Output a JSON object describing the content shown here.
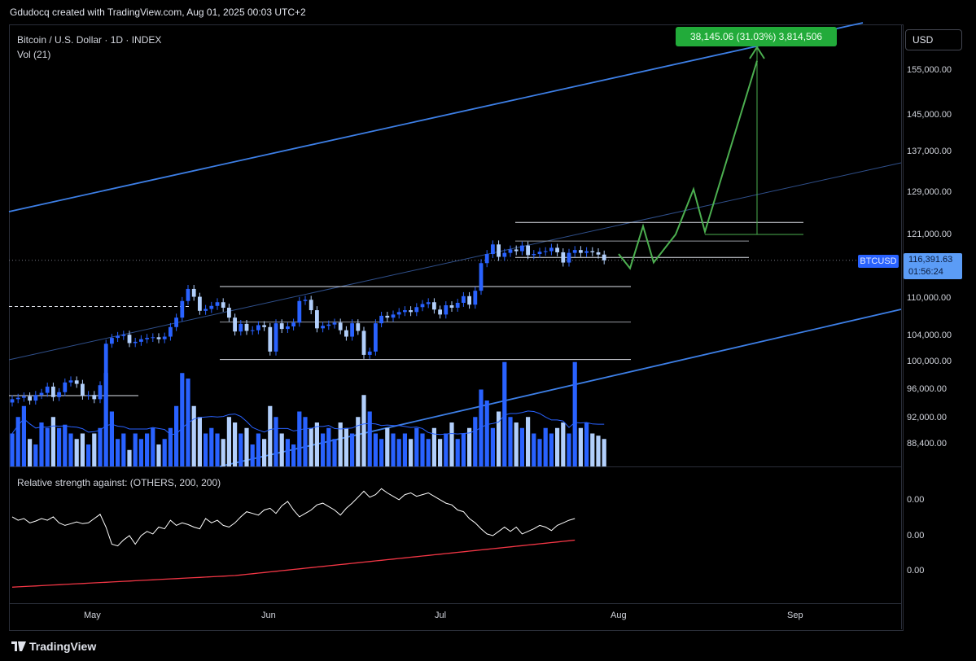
{
  "header": {
    "caption": "Gdudocq created with TradingView.com, Aug 01, 2025 00:03 UTC+2"
  },
  "legend": {
    "symbol": "Bitcoin / U.S. Dollar · 1D · INDEX",
    "volume": "Vol (21)"
  },
  "rs_pane": {
    "title": "Relative strength against: (OTHERS, 200, 200)",
    "ticks": [
      "0.00",
      "0.00",
      "0.00"
    ]
  },
  "price_axis": {
    "currency_button": "USD",
    "ticks": [
      "155,000.00",
      "145,000.00",
      "137,000.00",
      "129,000.00",
      "121,000.00",
      "110,000.00",
      "104,000.00",
      "100,000.00",
      "96,000.00",
      "92,000.00",
      "88,400.00"
    ],
    "symbol_tag": "BTCUSD",
    "current_price": "116,391.63",
    "countdown": "01:56:24"
  },
  "time_axis": {
    "labels": [
      "May",
      "Jun",
      "Jul",
      "Aug",
      "Sep"
    ]
  },
  "measure_label": "38,145.06 (31.03%) 3,814,506",
  "footer": {
    "brand": "TradingView"
  },
  "colors": {
    "up": "#2962ff",
    "down": "#b2cffb",
    "channel": "#3d7fe6",
    "projection": "#4caf50",
    "rs_line": "#ffffff",
    "rs_ma": "#f23645"
  },
  "chart_data": {
    "type": "candlestick",
    "title": "Bitcoin / U.S. Dollar · 1D · INDEX",
    "xlabels": [
      "May",
      "Jun",
      "Jul",
      "Aug",
      "Sep"
    ],
    "ylim": [
      86000,
      160000
    ],
    "y_axis_scale": "log",
    "closes": [
      94500,
      94700,
      94900,
      94300,
      95100,
      95400,
      96300,
      94800,
      95500,
      96900,
      97200,
      96700,
      95000,
      95100,
      94500,
      96500,
      102700,
      103600,
      103900,
      104100,
      102800,
      103000,
      103400,
      103600,
      103700,
      103400,
      103800,
      105300,
      106800,
      109500,
      111500,
      110200,
      107900,
      108200,
      108700,
      109300,
      108400,
      106800,
      104600,
      105800,
      104700,
      104800,
      105600,
      105300,
      101500,
      105900,
      105000,
      105400,
      106000,
      109500,
      109700,
      108000,
      105100,
      105500,
      105700,
      106000,
      104800,
      103800,
      105900,
      104700,
      101000,
      101500,
      105900,
      107100,
      106800,
      107300,
      107700,
      108000,
      107700,
      108500,
      109000,
      109300,
      108100,
      107300,
      108800,
      108400,
      109200,
      110300,
      108900,
      111200,
      115900,
      117500,
      119200,
      117000,
      117700,
      118300,
      118000,
      119000,
      117300,
      117500,
      117900,
      118000,
      118600,
      117800,
      116000,
      117700,
      118200,
      117700,
      118000,
      117800,
      117400,
      116400
    ],
    "volume_rel": [
      0.3,
      0.45,
      0.55,
      0.25,
      0.2,
      0.4,
      0.35,
      0.45,
      0.35,
      0.38,
      0.3,
      0.25,
      0.3,
      0.2,
      0.3,
      0.35,
      0.85,
      0.5,
      0.25,
      0.3,
      0.15,
      0.3,
      0.25,
      0.3,
      0.35,
      0.2,
      0.25,
      0.35,
      0.55,
      0.85,
      0.8,
      0.55,
      0.45,
      0.3,
      0.35,
      0.3,
      0.25,
      0.45,
      0.4,
      0.3,
      0.35,
      0.2,
      0.3,
      0.25,
      0.55,
      0.45,
      0.3,
      0.25,
      0.2,
      0.5,
      0.45,
      0.35,
      0.4,
      0.3,
      0.35,
      0.25,
      0.4,
      0.35,
      0.3,
      0.45,
      0.65,
      0.5,
      0.3,
      0.25,
      0.35,
      0.3,
      0.25,
      0.3,
      0.25,
      0.35,
      0.3,
      0.25,
      0.35,
      0.25,
      0.3,
      0.4,
      0.25,
      0.3,
      0.35,
      0.45,
      0.7,
      0.6,
      0.35,
      0.5,
      0.95,
      0.45,
      0.4,
      0.35,
      0.45,
      0.3,
      0.25,
      0.35,
      0.3,
      0.35,
      0.4,
      0.3,
      0.95,
      0.35,
      0.4,
      0.3,
      0.28,
      0.25
    ],
    "relative_strength": [
      0.62,
      0.58,
      0.6,
      0.55,
      0.57,
      0.6,
      0.58,
      0.62,
      0.55,
      0.52,
      0.54,
      0.56,
      0.54,
      0.55,
      0.6,
      0.65,
      0.5,
      0.3,
      0.28,
      0.35,
      0.4,
      0.3,
      0.4,
      0.45,
      0.42,
      0.5,
      0.48,
      0.58,
      0.52,
      0.55,
      0.53,
      0.5,
      0.48,
      0.6,
      0.55,
      0.58,
      0.52,
      0.5,
      0.55,
      0.62,
      0.68,
      0.66,
      0.64,
      0.7,
      0.72,
      0.66,
      0.75,
      0.8,
      0.7,
      0.62,
      0.66,
      0.7,
      0.76,
      0.78,
      0.74,
      0.7,
      0.64,
      0.72,
      0.78,
      0.85,
      0.92,
      0.85,
      0.88,
      0.95,
      0.9,
      0.86,
      0.82,
      0.88,
      0.9,
      0.86,
      0.88,
      0.9,
      0.86,
      0.82,
      0.78,
      0.76,
      0.7,
      0.68,
      0.6,
      0.55,
      0.48,
      0.42,
      0.4,
      0.45,
      0.5,
      0.45,
      0.5,
      0.42,
      0.45,
      0.48,
      0.52,
      0.5,
      0.46,
      0.52,
      0.55,
      0.58,
      0.6
    ],
    "relative_strength_ma": [
      0.05,
      0.055,
      0.06,
      0.065,
      0.07,
      0.075,
      0.08,
      0.085,
      0.09,
      0.095,
      0.1,
      0.105,
      0.11,
      0.115,
      0.12,
      0.125,
      0.13,
      0.135,
      0.14,
      0.145,
      0.15,
      0.155,
      0.16,
      0.165,
      0.17,
      0.175,
      0.18,
      0.185,
      0.19,
      0.195,
      0.2,
      0.205,
      0.21,
      0.215,
      0.22,
      0.225,
      0.23,
      0.235,
      0.24,
      0.25,
      0.26,
      0.27,
      0.28,
      0.29,
      0.3,
      0.31,
      0.32,
      0.33,
      0.34,
      0.35,
      0.36,
      0.37,
      0.38,
      0.39,
      0.4,
      0.41,
      0.42,
      0.43,
      0.44,
      0.45,
      0.46,
      0.47,
      0.48,
      0.49,
      0.5,
      0.51,
      0.52,
      0.53,
      0.54,
      0.55,
      0.56,
      0.57,
      0.58,
      0.59,
      0.6,
      0.61,
      0.62,
      0.63,
      0.64,
      0.65,
      0.66,
      0.67,
      0.68,
      0.69,
      0.7,
      0.71,
      0.72,
      0.73,
      0.74,
      0.75,
      0.76,
      0.77,
      0.78,
      0.79,
      0.8,
      0.81,
      0.82
    ],
    "projection_path_prices": [
      117500,
      115000,
      122500,
      116000,
      121000,
      129500,
      121500,
      157000
    ],
    "measure_from_to": [
      121000,
      157000
    ],
    "annotations": [
      "38,145.06 (31.03%) 3,814,506"
    ]
  }
}
